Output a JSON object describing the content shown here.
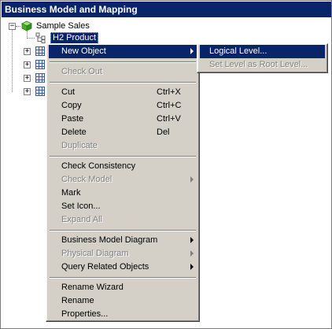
{
  "window": {
    "title": "Business Model and Mapping"
  },
  "tree": {
    "root_label": "Sample Sales",
    "selected_label": "H2 Product",
    "collapsed_items": [
      "",
      "",
      "",
      ""
    ]
  },
  "context_menu": {
    "new_object": "New Object",
    "check_out": "Check Out",
    "cut": "Cut",
    "cut_shortcut": "Ctrl+X",
    "copy": "Copy",
    "copy_shortcut": "Ctrl+C",
    "paste": "Paste",
    "paste_shortcut": "Ctrl+V",
    "delete": "Delete",
    "delete_shortcut": "Del",
    "duplicate": "Duplicate",
    "check_consistency": "Check Consistency",
    "check_model": "Check Model",
    "mark": "Mark",
    "set_icon": "Set Icon...",
    "expand_all": "Expand All",
    "business_model_diagram": "Business Model Diagram",
    "physical_diagram": "Physical Diagram",
    "query_related_objects": "Query Related Objects",
    "rename_wizard": "Rename Wizard",
    "rename": "Rename",
    "properties": "Properties..."
  },
  "submenu": {
    "logical_level": "Logical Level...",
    "set_level_as_root": "Set Level as Root Level..."
  },
  "colors": {
    "highlight": "#0a246a",
    "menu_bg": "#d4d0c8",
    "disabled": "#808080"
  }
}
